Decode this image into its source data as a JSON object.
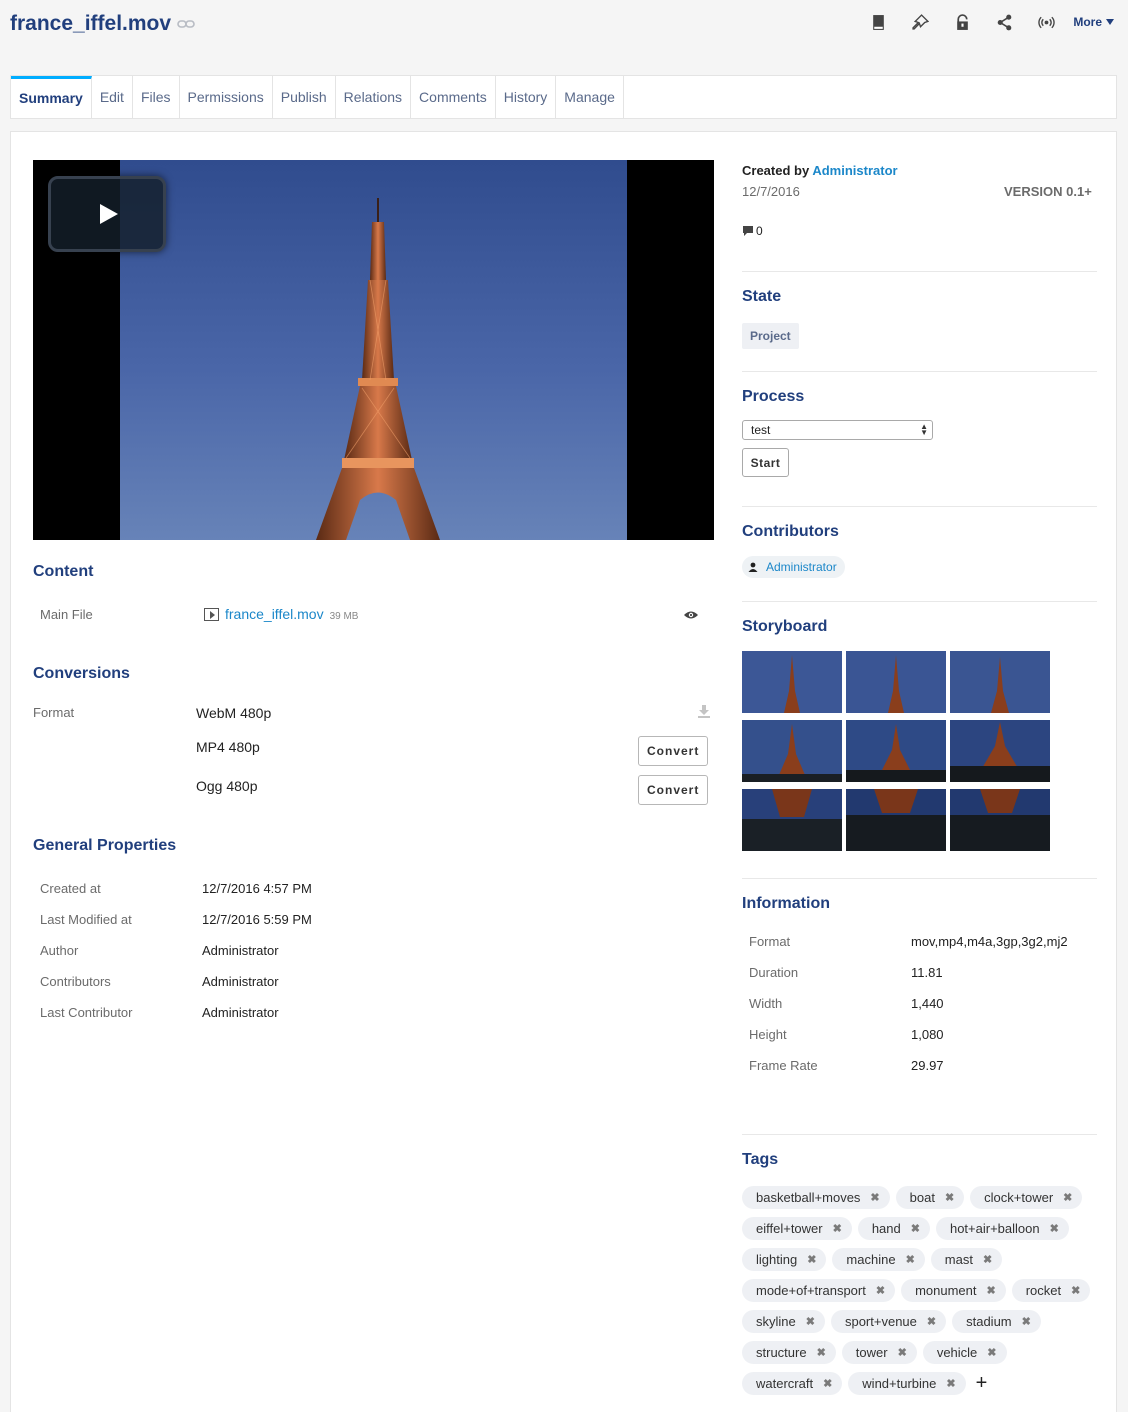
{
  "document": {
    "title": "france_iffel.mov"
  },
  "toolbar": {
    "more_label": "More"
  },
  "tabs": [
    "Summary",
    "Edit",
    "Files",
    "Permissions",
    "Publish",
    "Relations",
    "Comments",
    "History",
    "Manage"
  ],
  "content": {
    "heading": "Content",
    "main_file_label": "Main File",
    "file_name": "france_iffel.mov",
    "file_size": "39 MB"
  },
  "conversions": {
    "heading": "Conversions",
    "format_label": "Format",
    "items": [
      {
        "name": "WebM 480p",
        "action": ""
      },
      {
        "name": "MP4 480p",
        "action": "Convert"
      },
      {
        "name": "Ogg 480p",
        "action": "Convert"
      }
    ]
  },
  "general": {
    "heading": "General Properties",
    "rows": [
      {
        "label": "Created at",
        "value": "12/7/2016 4:57 PM"
      },
      {
        "label": "Last Modified at",
        "value": "12/7/2016 5:59 PM"
      },
      {
        "label": "Author",
        "value": "Administrator"
      },
      {
        "label": "Contributors",
        "value": "Administrator"
      },
      {
        "label": "Last Contributor",
        "value": "Administrator"
      }
    ]
  },
  "meta": {
    "created_by_label": "Created by",
    "created_by": "Administrator",
    "date": "12/7/2016",
    "version": "VERSION 0.1+",
    "comment_count": "0"
  },
  "state": {
    "heading": "State",
    "value": "Project"
  },
  "process": {
    "heading": "Process",
    "selected": "test",
    "start_label": "Start"
  },
  "contributors": {
    "heading": "Contributors",
    "user": "Administrator"
  },
  "storyboard": {
    "heading": "Storyboard",
    "frames": 9
  },
  "information": {
    "heading": "Information",
    "rows": [
      {
        "label": "Format",
        "value": "mov,mp4,m4a,3gp,3g2,mj2"
      },
      {
        "label": "Duration",
        "value": "11.81"
      },
      {
        "label": "Width",
        "value": "1,440"
      },
      {
        "label": "Height",
        "value": "1,080"
      },
      {
        "label": "Frame Rate",
        "value": "29.97"
      }
    ]
  },
  "tags": {
    "heading": "Tags",
    "items": [
      "basketball+moves",
      "boat",
      "clock+tower",
      "eiffel+tower",
      "hand",
      "hot+air+balloon",
      "lighting",
      "machine",
      "mast",
      "mode+of+transport",
      "monument",
      "rocket",
      "skyline",
      "sport+venue",
      "stadium",
      "structure",
      "tower",
      "vehicle",
      "watercraft",
      "wind+turbine"
    ],
    "remove_glyph": "✖",
    "add_glyph": "+"
  },
  "colors": {
    "title": "#213f7d",
    "link": "#1b87c9",
    "active_tab_accent": "#00adff"
  }
}
